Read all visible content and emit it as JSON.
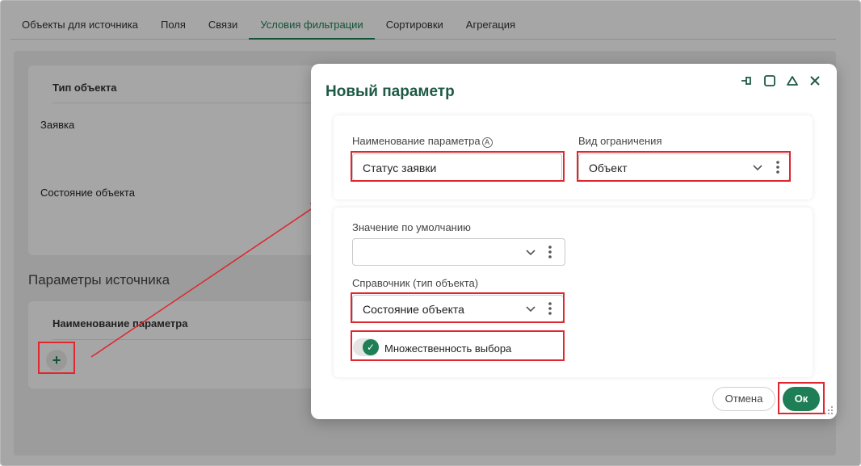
{
  "tabs": [
    "Объекты для источника",
    "Поля",
    "Связи",
    "Условия фильтрации",
    "Сортировки",
    "Агрегация"
  ],
  "active_tab": "Условия фильтрации",
  "object_table": {
    "header": "Тип объекта",
    "rows": [
      "Заявка",
      "Состояние объекта"
    ]
  },
  "source_params": {
    "title": "Параметры источника",
    "header": "Наименование параметра",
    "add_label": "+"
  },
  "dialog": {
    "title": "Новый параметр",
    "param_name": {
      "label": "Наименование параметра",
      "value": "Статус заявки",
      "info": "A"
    },
    "restriction": {
      "label": "Вид ограничения",
      "value": "Объект"
    },
    "default_value": {
      "label": "Значение по умолчанию",
      "value": ""
    },
    "reference": {
      "label": "Справочник (тип объекта)",
      "value": "Состояние объекта"
    },
    "multi_select": {
      "label": "Множественность выбора",
      "checked": true
    },
    "cancel_label": "Отмена",
    "ok_label": "Ок"
  },
  "colors": {
    "accent": "#1e7e55",
    "annotation": "#e0262f"
  },
  "icons": [
    "pin-icon",
    "maximize-icon",
    "collapse-icon",
    "close-icon",
    "chevron-down-icon",
    "more-vertical-icon",
    "check-icon",
    "resize-handle-icon"
  ]
}
